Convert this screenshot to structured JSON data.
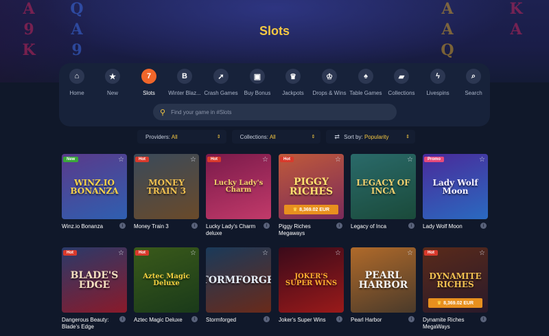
{
  "page": {
    "title": "Slots"
  },
  "hero": {
    "reel_symbols_left": [
      "A",
      "9",
      "K",
      "Q",
      "A",
      "9"
    ],
    "reel_symbols_right": [
      "A",
      "A",
      "Q",
      "K",
      "A"
    ]
  },
  "nav": {
    "items": [
      {
        "label": "Home",
        "icon": "home-icon",
        "glyph": "⌂",
        "active": false
      },
      {
        "label": "New",
        "icon": "star-icon",
        "glyph": "★",
        "active": false
      },
      {
        "label": "Slots",
        "icon": "slots-icon",
        "glyph": "7",
        "active": true
      },
      {
        "label": "Winter Blaz...",
        "icon": "b-letter-icon",
        "glyph": "B",
        "active": false
      },
      {
        "label": "Crash Games",
        "icon": "rocket-icon",
        "glyph": "➚",
        "active": false
      },
      {
        "label": "Buy Bonus",
        "icon": "gift-icon",
        "glyph": "▣",
        "active": false
      },
      {
        "label": "Jackpots",
        "icon": "trophy-icon",
        "glyph": "♛",
        "active": false
      },
      {
        "label": "Drops & Wins",
        "icon": "crown-icon",
        "glyph": "♔",
        "active": false
      },
      {
        "label": "Table Games",
        "icon": "spade-icon",
        "glyph": "♠",
        "active": false
      },
      {
        "label": "Collections",
        "icon": "folder-icon",
        "glyph": "▰",
        "active": false
      },
      {
        "label": "Livespins",
        "icon": "livespins-icon",
        "glyph": "ϟ",
        "active": false
      },
      {
        "label": "Search",
        "icon": "search-icon",
        "glyph": "⌕",
        "active": false
      }
    ]
  },
  "search": {
    "placeholder": "Find your game in #Slots",
    "value": ""
  },
  "filters": {
    "providers": {
      "label": "Providers:",
      "value": "All"
    },
    "collections": {
      "label": "Collections:",
      "value": "All"
    },
    "sort": {
      "label": "Sort by:",
      "value": "Popularity"
    }
  },
  "games": [
    {
      "name": "Winz.io Bonanza",
      "badge": "New",
      "badge_type": "new",
      "art": "WINZ.IO BONANZA",
      "bg": "#5a3a8a",
      "bg2": "#2f5fb0",
      "art_color": "#f6d24a",
      "jackpot": ""
    },
    {
      "name": "Money Train 3",
      "badge": "Hot",
      "badge_type": "hot",
      "art": "MONEY TRAIN 3",
      "bg": "#3a4a5a",
      "bg2": "#6a4a2a",
      "art_color": "#f0c050",
      "jackpot": ""
    },
    {
      "name": "Lucky Lady's Charm deluxe",
      "badge": "Hot",
      "badge_type": "hot",
      "art": "Lucky Lady's Charm",
      "bg": "#7a1a4a",
      "bg2": "#c23a6a",
      "art_color": "#f3d36a",
      "jackpot": ""
    },
    {
      "name": "Piggy Riches Megaways",
      "badge": "Hot",
      "badge_type": "hot",
      "art": "PIGGY RICHES",
      "bg": "#c05a3a",
      "bg2": "#7a2a5a",
      "art_color": "#ffe070",
      "jackpot": "8,369.02 EUR"
    },
    {
      "name": "Legacy of Inca",
      "badge": "",
      "badge_type": "",
      "art": "LEGACY OF INCA",
      "bg": "#2a6a6a",
      "bg2": "#1a4a3a",
      "art_color": "#f0d070",
      "jackpot": ""
    },
    {
      "name": "Lady Wolf Moon",
      "badge": "Promo",
      "badge_type": "promo",
      "art": "Lady Wolf Moon",
      "bg": "#4a2a9a",
      "bg2": "#2a6ac0",
      "art_color": "#f7f2ff",
      "jackpot": ""
    },
    {
      "name": "Dangerous Beauty: Blade's Edge",
      "badge": "Hot",
      "badge_type": "hot",
      "art": "BLADE'S EDGE",
      "bg": "#2a3a6a",
      "bg2": "#8a1a2a",
      "art_color": "#f4e0c0",
      "jackpot": ""
    },
    {
      "name": "Aztec Magic Deluxe",
      "badge": "Hot",
      "badge_type": "hot",
      "art": "Aztec Magic Deluxe",
      "bg": "#3a5a1a",
      "bg2": "#1a3a1a",
      "art_color": "#f5d040",
      "jackpot": ""
    },
    {
      "name": "Stormforged",
      "badge": "",
      "badge_type": "",
      "art": "STORMFORGED",
      "bg": "#1a3a5a",
      "bg2": "#6a2a1a",
      "art_color": "#e6eef8",
      "jackpot": ""
    },
    {
      "name": "Joker's Super Wins",
      "badge": "",
      "badge_type": "",
      "art": "JOKER'S SUPER WINS",
      "bg": "#3a0a1a",
      "bg2": "#9a1a1a",
      "art_color": "#ffb030",
      "jackpot": ""
    },
    {
      "name": "Pearl Harbor",
      "badge": "",
      "badge_type": "",
      "art": "PEARL HARBOR",
      "bg": "#b06a2a",
      "bg2": "#4a3a2a",
      "art_color": "#f2f2f2",
      "jackpot": ""
    },
    {
      "name": "Dynamite Riches MegaWays",
      "badge": "Hot",
      "badge_type": "hot",
      "art": "DYNAMITE RICHES",
      "bg": "#5a2a1a",
      "bg2": "#2a1a2a",
      "art_color": "#f0c050",
      "jackpot": "8,369.02 EUR"
    }
  ],
  "colors": {
    "accent": "#f5c842",
    "active_nav": "#f0662a",
    "hot": "#d93a2c",
    "new": "#3aa83a",
    "promo": "#e64a7a",
    "jackpot": "#e8901e"
  }
}
